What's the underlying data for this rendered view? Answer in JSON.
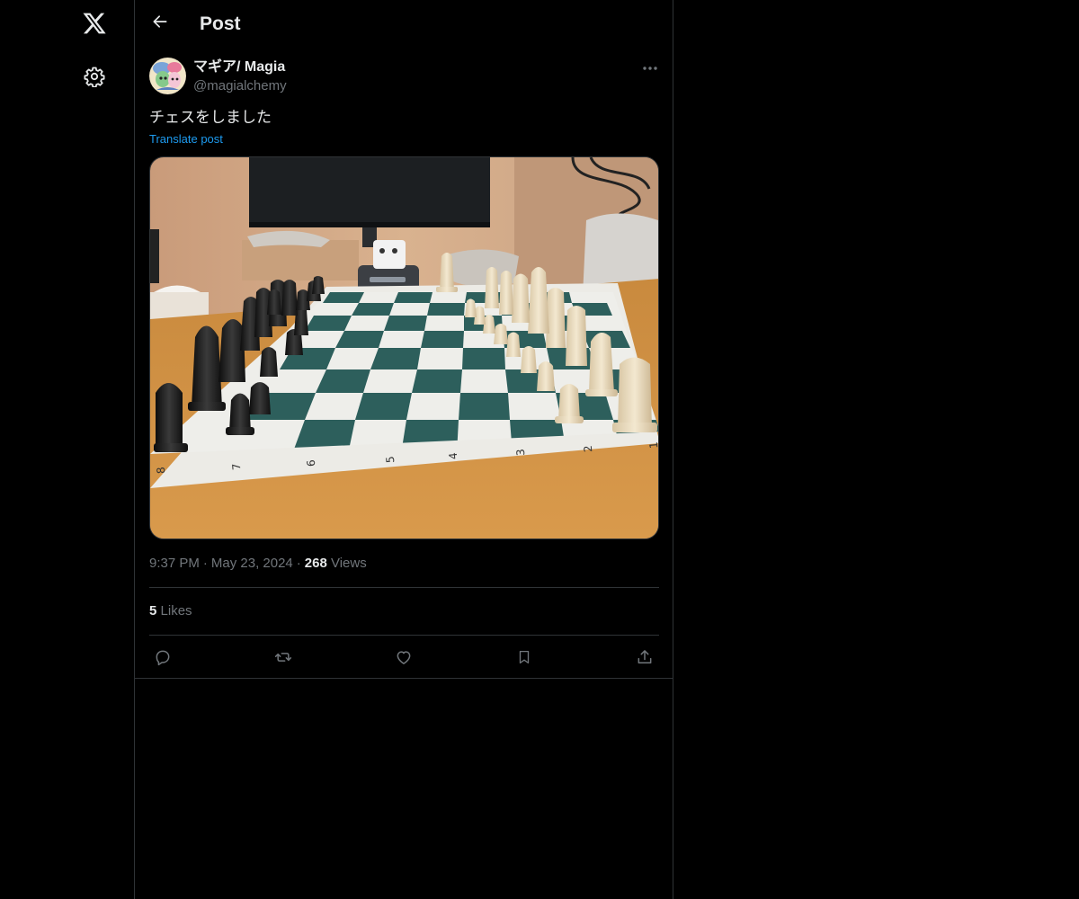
{
  "header": {
    "title": "Post"
  },
  "nav": {
    "logo_icon": "x-logo-icon",
    "settings_icon": "gear-icon"
  },
  "post": {
    "author": {
      "display_name": "マギア/ Magia",
      "handle": "@magialchemy"
    },
    "text": "チェスをしました",
    "translate_label": "Translate post",
    "media": {
      "board_file_labels": [
        "8",
        "7",
        "6",
        "5",
        "4",
        "3",
        "2",
        "1"
      ]
    },
    "meta": {
      "time": "9:37 PM",
      "separator": "·",
      "date": "May 23, 2024",
      "views_count": "268",
      "views_label": "Views"
    },
    "likes": {
      "count": "5",
      "label": "Likes"
    },
    "actions": [
      {
        "name": "reply",
        "icon": "reply-icon"
      },
      {
        "name": "repost",
        "icon": "repost-icon"
      },
      {
        "name": "like",
        "icon": "heart-icon"
      },
      {
        "name": "bookmark",
        "icon": "bookmark-icon"
      },
      {
        "name": "share",
        "icon": "share-icon"
      }
    ]
  },
  "colors": {
    "background": "#000000",
    "text_primary": "#e7e9ea",
    "text_secondary": "#71767b",
    "accent": "#1d9bf0",
    "border": "#2f3336",
    "board_dark": "#2d5f5c"
  }
}
